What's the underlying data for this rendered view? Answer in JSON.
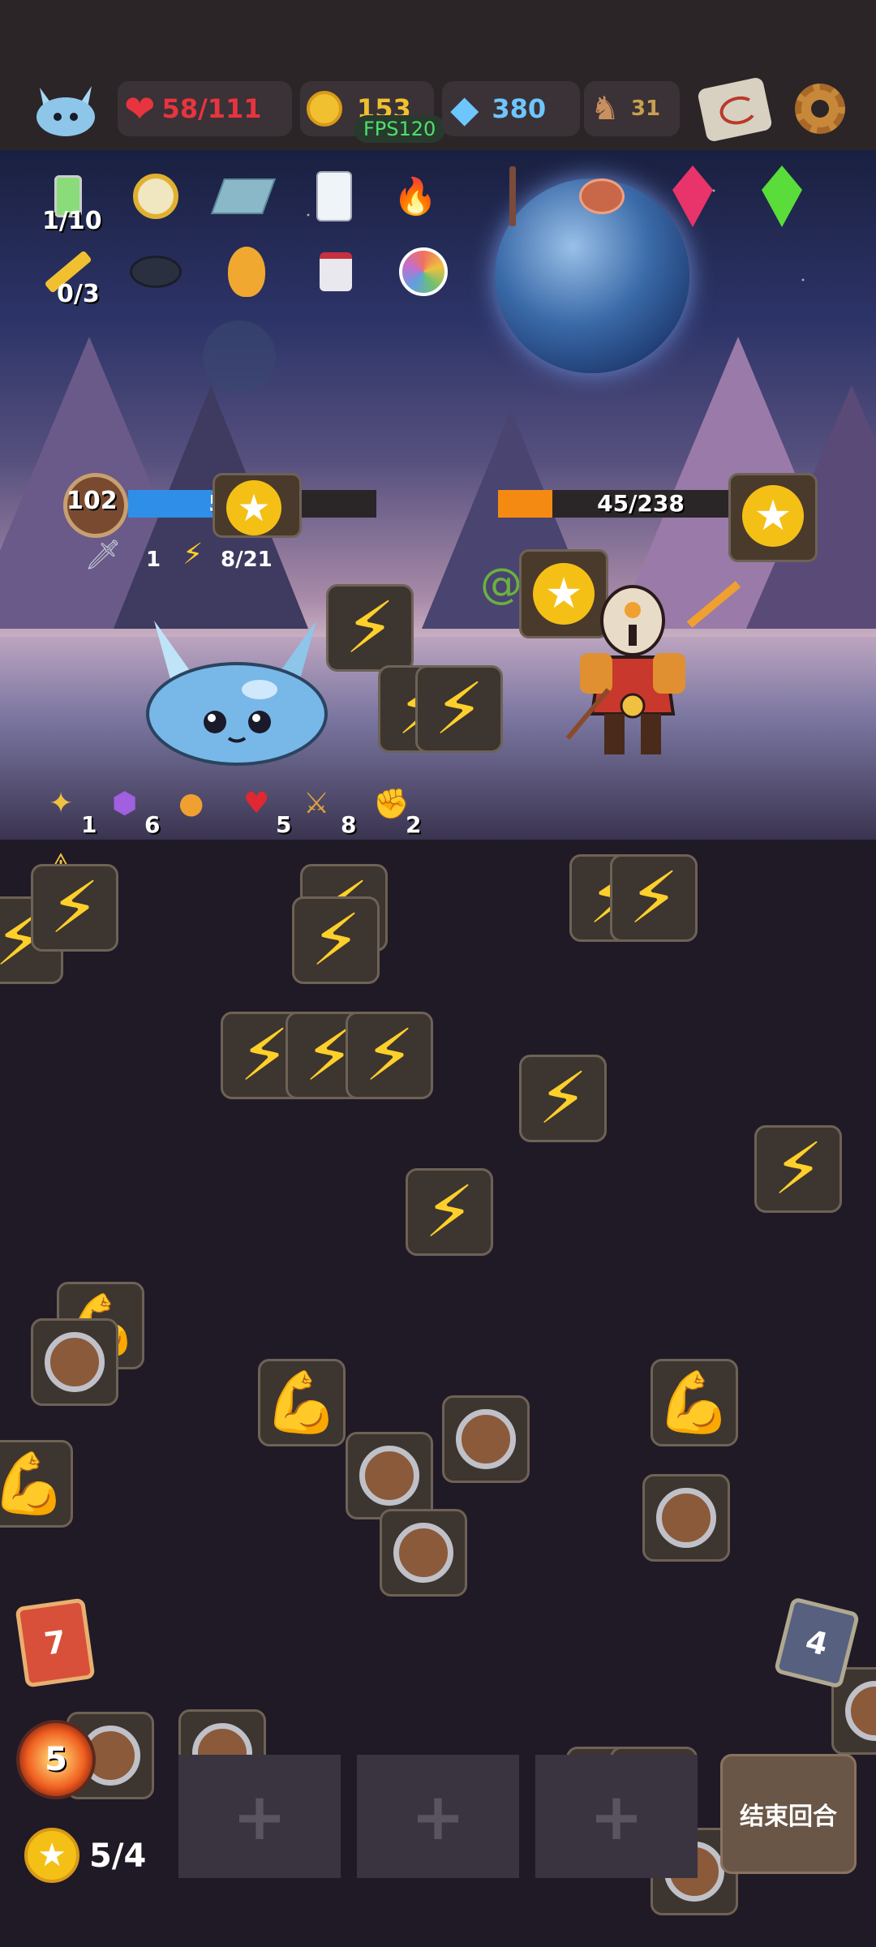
{
  "topbar": {
    "hp": "58/111",
    "gold": "153",
    "gems": "380",
    "horns": "31",
    "fps": "FPS120"
  },
  "inventory": {
    "potion_count": "1/10",
    "knife_count": "0/3"
  },
  "player": {
    "level": "102",
    "hp": "58/111",
    "hp_fraction": 0.52,
    "attack": "1",
    "energy": "8/21"
  },
  "enemy": {
    "hp": "45/238",
    "hp_fraction": 0.19
  },
  "status_effects": [
    "1",
    "6",
    "5",
    "8",
    "2"
  ],
  "status_warning": "5",
  "bottom": {
    "left_card_count": "7",
    "right_card_count": "4",
    "fire_count": "5",
    "star_count": "5/4",
    "end_turn_label": "结束回合",
    "slot_plus": "+"
  },
  "colors": {
    "hp_red": "#e8343f",
    "gold": "#f0c030",
    "gem_blue": "#6ec6ff",
    "player_bar": "#2f8fe8",
    "enemy_bar": "#f58a12",
    "bolt": "#ffd02a"
  }
}
